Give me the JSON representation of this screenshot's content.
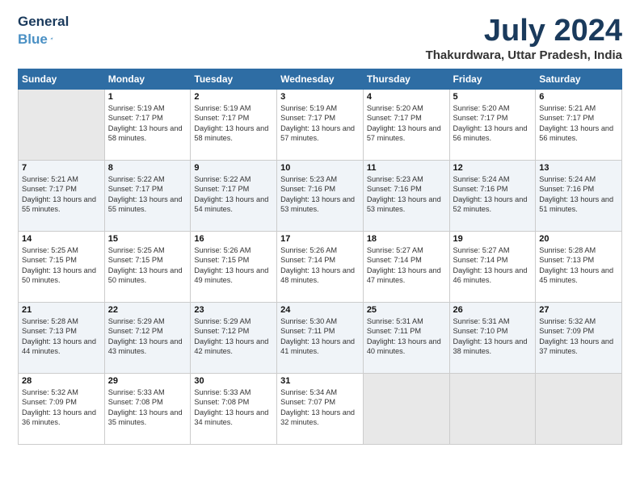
{
  "logo": {
    "line1": "General",
    "line2": "Blue",
    "bird": "🐦"
  },
  "title": "July 2024",
  "location": "Thakurdwara, Uttar Pradesh, India",
  "columns": [
    "Sunday",
    "Monday",
    "Tuesday",
    "Wednesday",
    "Thursday",
    "Friday",
    "Saturday"
  ],
  "weeks": [
    [
      {
        "day": "",
        "sunrise": "",
        "sunset": "",
        "daylight": "",
        "empty": true
      },
      {
        "day": "1",
        "sunrise": "5:19 AM",
        "sunset": "7:17 PM",
        "daylight": "13 hours and 58 minutes."
      },
      {
        "day": "2",
        "sunrise": "5:19 AM",
        "sunset": "7:17 PM",
        "daylight": "13 hours and 58 minutes."
      },
      {
        "day": "3",
        "sunrise": "5:19 AM",
        "sunset": "7:17 PM",
        "daylight": "13 hours and 57 minutes."
      },
      {
        "day": "4",
        "sunrise": "5:20 AM",
        "sunset": "7:17 PM",
        "daylight": "13 hours and 57 minutes."
      },
      {
        "day": "5",
        "sunrise": "5:20 AM",
        "sunset": "7:17 PM",
        "daylight": "13 hours and 56 minutes."
      },
      {
        "day": "6",
        "sunrise": "5:21 AM",
        "sunset": "7:17 PM",
        "daylight": "13 hours and 56 minutes."
      }
    ],
    [
      {
        "day": "7",
        "sunrise": "5:21 AM",
        "sunset": "7:17 PM",
        "daylight": "13 hours and 55 minutes."
      },
      {
        "day": "8",
        "sunrise": "5:22 AM",
        "sunset": "7:17 PM",
        "daylight": "13 hours and 55 minutes."
      },
      {
        "day": "9",
        "sunrise": "5:22 AM",
        "sunset": "7:17 PM",
        "daylight": "13 hours and 54 minutes."
      },
      {
        "day": "10",
        "sunrise": "5:23 AM",
        "sunset": "7:16 PM",
        "daylight": "13 hours and 53 minutes."
      },
      {
        "day": "11",
        "sunrise": "5:23 AM",
        "sunset": "7:16 PM",
        "daylight": "13 hours and 53 minutes."
      },
      {
        "day": "12",
        "sunrise": "5:24 AM",
        "sunset": "7:16 PM",
        "daylight": "13 hours and 52 minutes."
      },
      {
        "day": "13",
        "sunrise": "5:24 AM",
        "sunset": "7:16 PM",
        "daylight": "13 hours and 51 minutes."
      }
    ],
    [
      {
        "day": "14",
        "sunrise": "5:25 AM",
        "sunset": "7:15 PM",
        "daylight": "13 hours and 50 minutes."
      },
      {
        "day": "15",
        "sunrise": "5:25 AM",
        "sunset": "7:15 PM",
        "daylight": "13 hours and 50 minutes."
      },
      {
        "day": "16",
        "sunrise": "5:26 AM",
        "sunset": "7:15 PM",
        "daylight": "13 hours and 49 minutes."
      },
      {
        "day": "17",
        "sunrise": "5:26 AM",
        "sunset": "7:14 PM",
        "daylight": "13 hours and 48 minutes."
      },
      {
        "day": "18",
        "sunrise": "5:27 AM",
        "sunset": "7:14 PM",
        "daylight": "13 hours and 47 minutes."
      },
      {
        "day": "19",
        "sunrise": "5:27 AM",
        "sunset": "7:14 PM",
        "daylight": "13 hours and 46 minutes."
      },
      {
        "day": "20",
        "sunrise": "5:28 AM",
        "sunset": "7:13 PM",
        "daylight": "13 hours and 45 minutes."
      }
    ],
    [
      {
        "day": "21",
        "sunrise": "5:28 AM",
        "sunset": "7:13 PM",
        "daylight": "13 hours and 44 minutes."
      },
      {
        "day": "22",
        "sunrise": "5:29 AM",
        "sunset": "7:12 PM",
        "daylight": "13 hours and 43 minutes."
      },
      {
        "day": "23",
        "sunrise": "5:29 AM",
        "sunset": "7:12 PM",
        "daylight": "13 hours and 42 minutes."
      },
      {
        "day": "24",
        "sunrise": "5:30 AM",
        "sunset": "7:11 PM",
        "daylight": "13 hours and 41 minutes."
      },
      {
        "day": "25",
        "sunrise": "5:31 AM",
        "sunset": "7:11 PM",
        "daylight": "13 hours and 40 minutes."
      },
      {
        "day": "26",
        "sunrise": "5:31 AM",
        "sunset": "7:10 PM",
        "daylight": "13 hours and 38 minutes."
      },
      {
        "day": "27",
        "sunrise": "5:32 AM",
        "sunset": "7:09 PM",
        "daylight": "13 hours and 37 minutes."
      }
    ],
    [
      {
        "day": "28",
        "sunrise": "5:32 AM",
        "sunset": "7:09 PM",
        "daylight": "13 hours and 36 minutes."
      },
      {
        "day": "29",
        "sunrise": "5:33 AM",
        "sunset": "7:08 PM",
        "daylight": "13 hours and 35 minutes."
      },
      {
        "day": "30",
        "sunrise": "5:33 AM",
        "sunset": "7:08 PM",
        "daylight": "13 hours and 34 minutes."
      },
      {
        "day": "31",
        "sunrise": "5:34 AM",
        "sunset": "7:07 PM",
        "daylight": "13 hours and 32 minutes."
      },
      {
        "day": "",
        "sunrise": "",
        "sunset": "",
        "daylight": "",
        "empty": true
      },
      {
        "day": "",
        "sunrise": "",
        "sunset": "",
        "daylight": "",
        "empty": true
      },
      {
        "day": "",
        "sunrise": "",
        "sunset": "",
        "daylight": "",
        "empty": true
      }
    ]
  ]
}
